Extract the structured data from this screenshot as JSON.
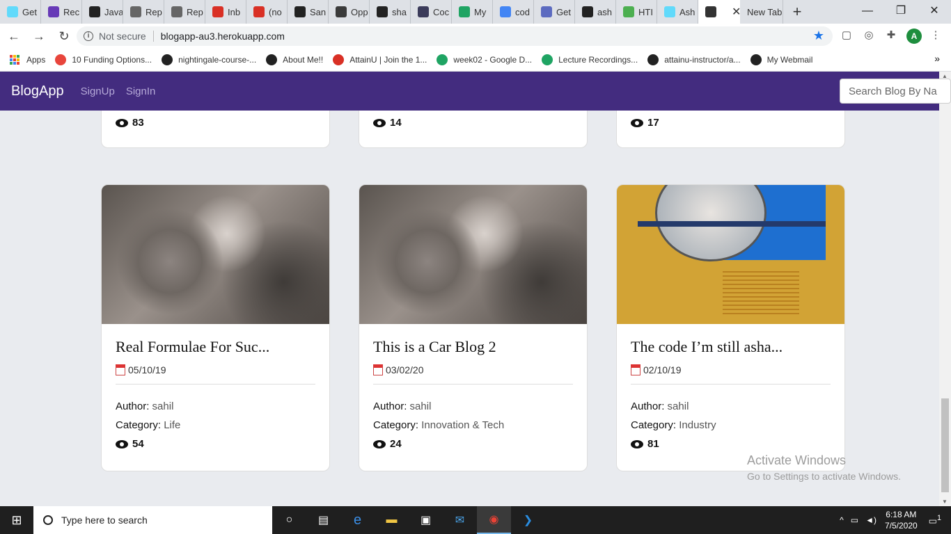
{
  "browser": {
    "tabs": [
      {
        "label": "Get",
        "icon": "react-icon",
        "color": "#61dafb"
      },
      {
        "label": "Rec",
        "icon": "list-icon",
        "color": "#673ab7"
      },
      {
        "label": "Java",
        "icon": "code-icon",
        "color": "#222222"
      },
      {
        "label": "Rep",
        "icon": "repl-icon",
        "color": "#666666"
      },
      {
        "label": "Rep",
        "icon": "repl-icon",
        "color": "#666666"
      },
      {
        "label": "Inb",
        "icon": "gmail-icon",
        "color": "#d93025"
      },
      {
        "label": "(no",
        "icon": "gmail-icon",
        "color": "#d93025"
      },
      {
        "label": "San",
        "icon": "github-icon",
        "color": "#222222"
      },
      {
        "label": "Opp",
        "icon": "linkedin-icon",
        "color": "#3a3a3a"
      },
      {
        "label": "sha",
        "icon": "github-icon",
        "color": "#222222"
      },
      {
        "label": "Coc",
        "icon": "book-icon",
        "color": "#3b3b5a"
      },
      {
        "label": "My",
        "icon": "drive-icon",
        "color": "#1fa463"
      },
      {
        "label": "cod",
        "icon": "google-icon",
        "color": "#4285f4"
      },
      {
        "label": "Get",
        "icon": "shield-icon",
        "color": "#5c6bc0"
      },
      {
        "label": "ash",
        "icon": "github-icon",
        "color": "#222222"
      },
      {
        "label": "HTI",
        "icon": "html-icon",
        "color": "#4caf50"
      },
      {
        "label": "Ash",
        "icon": "react-icon",
        "color": "#61dafb"
      },
      {
        "label": "",
        "icon": "globe-icon",
        "color": "#333333",
        "active": true
      },
      {
        "label": "New Tab",
        "icon": "",
        "color": ""
      }
    ],
    "new_tab_symbol": "+",
    "window_controls": {
      "minimize": "—",
      "maximize": "❐",
      "close": "✕"
    },
    "back_symbol": "←",
    "forward_symbol": "→",
    "reload_symbol": "↻",
    "not_secure": "Not secure",
    "url": "blogapp-au3.herokuapp.com",
    "star_symbol": "★",
    "profile_initial": "A",
    "bookmarks": [
      {
        "label": "Apps",
        "icon": "apps-grid-icon",
        "color": "#1a73e8"
      },
      {
        "label": "10 Funding Options...",
        "icon": "pinwheel-icon",
        "color": "#e8453c"
      },
      {
        "label": "nightingale-course-...",
        "icon": "github-icon",
        "color": "#222222"
      },
      {
        "label": "About Me!!",
        "icon": "globe-icon",
        "color": "#222222"
      },
      {
        "label": "AttainU | Join the 1...",
        "icon": "gmail-icon",
        "color": "#d93025"
      },
      {
        "label": "week02 - Google D...",
        "icon": "drive-icon",
        "color": "#1fa463"
      },
      {
        "label": "Lecture Recordings...",
        "icon": "drive-icon",
        "color": "#1fa463"
      },
      {
        "label": "attainu-instructor/a...",
        "icon": "github-icon",
        "color": "#222222"
      },
      {
        "label": "My Webmail",
        "icon": "globe-icon",
        "color": "#222222"
      }
    ],
    "bookmarks_more": "»"
  },
  "app": {
    "brand": "BlogApp",
    "nav": [
      "SignUp",
      "SignIn"
    ],
    "search_placeholder": "Search Blog By Na",
    "top_row_views": [
      "83",
      "14",
      "17"
    ],
    "cards": [
      {
        "title": "Real Formulae For Suc...",
        "date": "05/10/19",
        "author_label": "Author:",
        "author": "sahil",
        "category_label": "Category:",
        "category": "Life",
        "views": "54",
        "image": "olive-branch"
      },
      {
        "title": "This is a Car Blog 2",
        "date": "03/02/20",
        "author_label": "Author:",
        "author": "sahil",
        "category_label": "Category:",
        "category": "Innovation & Tech",
        "views": "24",
        "image": "olive-branch"
      },
      {
        "title": "The code I’m still asha...",
        "date": "02/10/19",
        "author_label": "Author:",
        "author": "sahil",
        "category_label": "Category:",
        "category": "Industry",
        "views": "81",
        "image": "pfizer-brochure"
      }
    ]
  },
  "watermark": {
    "line1": "Activate Windows",
    "line2": "Go to Settings to activate Windows."
  },
  "taskbar": {
    "search_placeholder": "Type here to search",
    "time": "6:18 AM",
    "date": "7/5/2020",
    "notification_count": "1"
  }
}
